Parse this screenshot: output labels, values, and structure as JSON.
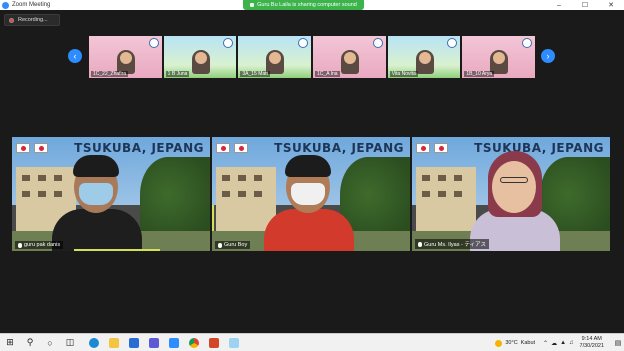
{
  "window": {
    "title": "Zoom Meeting",
    "share_banner": "Guru Bu Laila is sharing computer sound",
    "controls": [
      "minimize-icon",
      "maximize-icon",
      "close-icon"
    ]
  },
  "recording": {
    "label": "Recording..."
  },
  "gallery": {
    "thumbnails": [
      {
        "name": "1C_22_Zhafira",
        "bg": "pink"
      },
      {
        "name": "1 B Juna",
        "bg": "sky"
      },
      {
        "name": "3A_15 Matt",
        "bg": "sky"
      },
      {
        "name": "1C_A Ina",
        "bg": "pink"
      },
      {
        "name": "Vita Novita",
        "bg": "sky"
      },
      {
        "name": "1B_10 Arya",
        "bg": "pink"
      }
    ]
  },
  "tiles": [
    {
      "name": "guru pak danis",
      "heading": "TSUKUBA, JEPANG",
      "active": false,
      "speaking": true
    },
    {
      "name": "Guru Boy",
      "heading": "TSUKUBA, JEPANG",
      "active": true,
      "speaking": false
    },
    {
      "name": "Guru Ms. Ilyas - ティアス",
      "heading": "TSUKUBA, JEPANG",
      "active": false,
      "speaking": false
    }
  ],
  "taskbar": {
    "weather_temp": "30°C",
    "weather_text": "Kabut",
    "time": "9:14 AM",
    "date": "7/30/2021"
  },
  "colors": {
    "accent": "#2d8cff",
    "share_green": "#3cb44b",
    "active_outline": "#d4e157"
  }
}
